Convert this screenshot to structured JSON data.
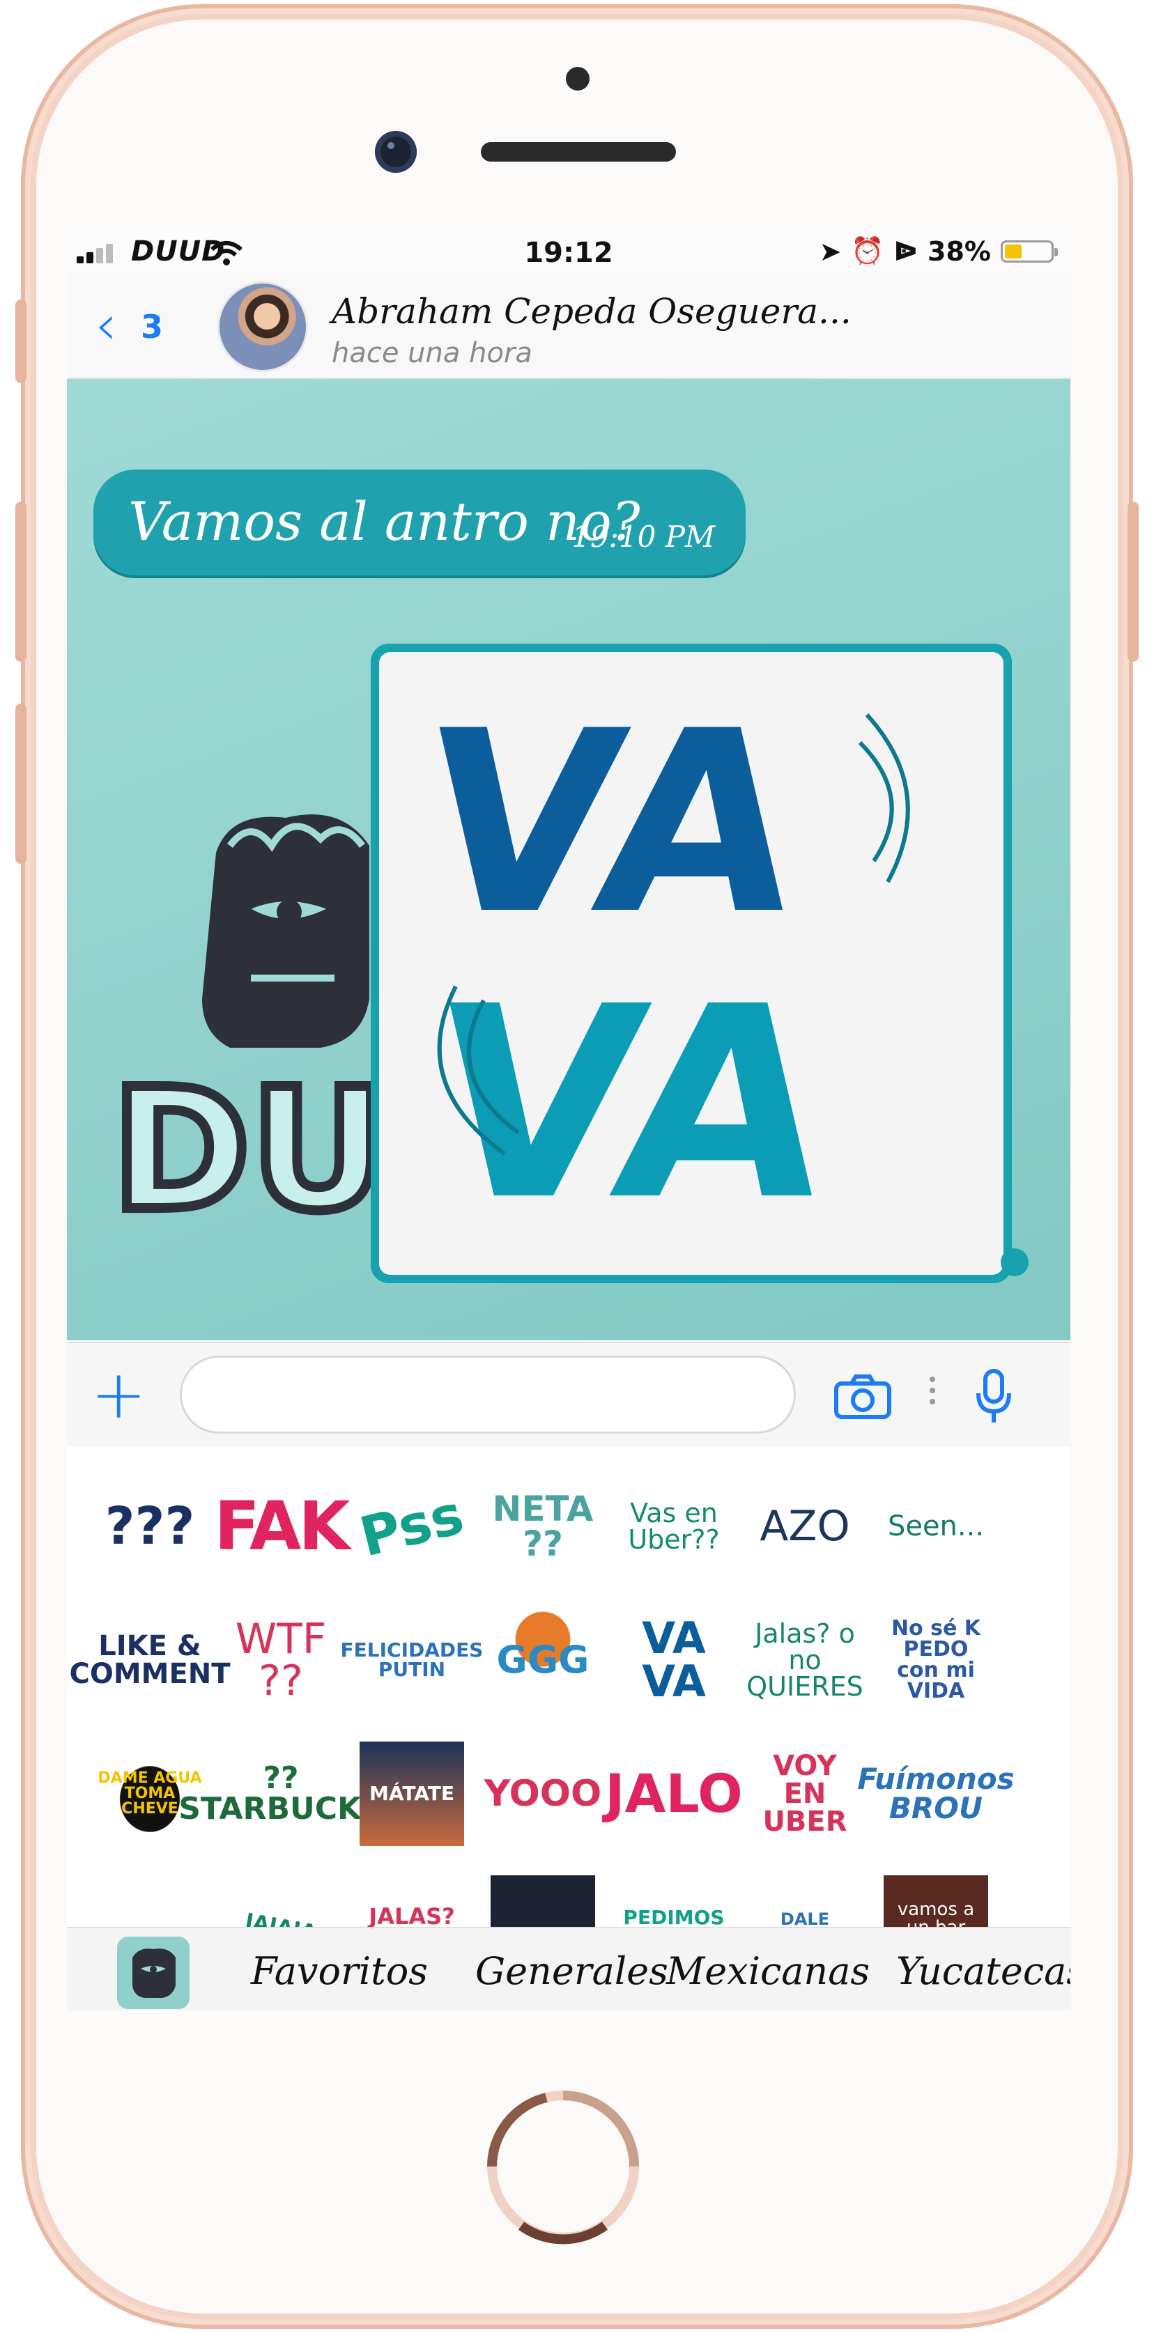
{
  "status_bar": {
    "carrier": "DUUD",
    "time": "19:12",
    "battery": "38%",
    "battery_level": 0.38
  },
  "header": {
    "back_count": "3",
    "contact_name": "Abraham Cepeda Oseguera...",
    "last_seen": "hace una hora"
  },
  "message": {
    "text": "Vamos al antro no?",
    "time": "19:10 PM"
  },
  "sent_sticker": {
    "top_line": "VA",
    "bottom_line": "VA"
  },
  "logo_text": "DU",
  "stickers": [
    {
      "label": "???"
    },
    {
      "label": "FAK"
    },
    {
      "label": "Pss"
    },
    {
      "label": "NETA ??"
    },
    {
      "label": "Vas en Uber??"
    },
    {
      "label": "AZO"
    },
    {
      "label": "Seen..."
    },
    {
      "label": "LIKE & COMMENT"
    },
    {
      "label": "WTF ??"
    },
    {
      "label": "FELICIDADES PUTIN"
    },
    {
      "label": "GGG"
    },
    {
      "label": "VA VA"
    },
    {
      "label": "Jalas? o no QUIERES"
    },
    {
      "label": "No sé K PEDO con mi VIDA"
    },
    {
      "label": "DAME AGUA TOMA CHEVE"
    },
    {
      "label": "?? STARBUCKS"
    },
    {
      "label": "MÁTATE"
    },
    {
      "label": "YOOO"
    },
    {
      "label": "JALO"
    },
    {
      "label": "VOY EN UBER"
    },
    {
      "label": "Fuímonos BROU"
    },
    {
      "label": "JAJAJA"
    },
    {
      "label": "JALAS? ?"
    },
    {
      "label": "PEDIMOS UBER!"
    },
    {
      "label": "DALE FOLLOW"
    },
    {
      "label": "vamos a un bar !!!!!!"
    }
  ],
  "tabs": [
    {
      "label": "Favoritos"
    },
    {
      "label": "Generales"
    },
    {
      "label": "Mexicanas"
    },
    {
      "label": "Yucatecas"
    }
  ],
  "colors": {
    "ios_blue": "#1c7cf3",
    "chat_background": "#94d4cf",
    "bubble": "#1fa2ad",
    "va_dark_blue": "#0c5d9c",
    "va_teal": "#0b9db5",
    "phone_frame": "#f4d3c4"
  }
}
